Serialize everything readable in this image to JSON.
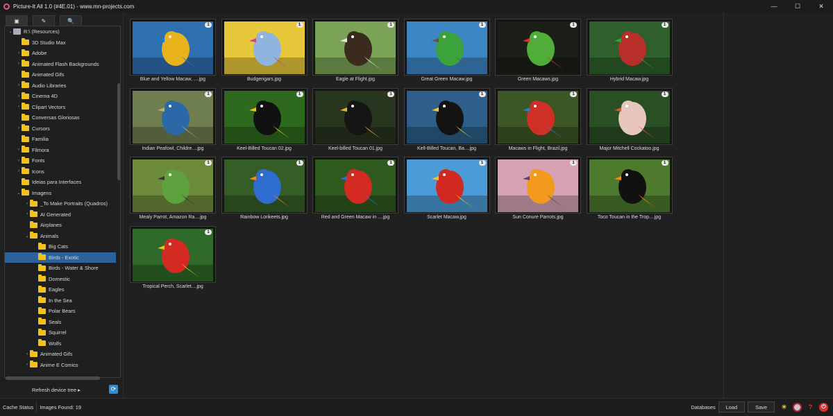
{
  "window": {
    "title": "Picture-It All 1.0 (#4E.01) - www.mn-projects.com",
    "minimize": "—",
    "maximize": "☐",
    "close": "✕"
  },
  "left_tabs": [
    "▣",
    "✎",
    "🔍"
  ],
  "tree": [
    {
      "label": "R:\\ (Resources)",
      "level": 0,
      "chev": "⌄",
      "type": "drive"
    },
    {
      "label": "3D Studio Max",
      "level": 1,
      "chev": ""
    },
    {
      "label": "Adobe",
      "level": 1,
      "chev": "›"
    },
    {
      "label": "Animated Flash Backgrounds",
      "level": 1,
      "chev": "›"
    },
    {
      "label": "Animated Gifs",
      "level": 1,
      "chev": ""
    },
    {
      "label": "Audio Libraries",
      "level": 1,
      "chev": "›"
    },
    {
      "label": "Cinema 4D",
      "level": 1,
      "chev": "›"
    },
    {
      "label": "Clipart Vectors",
      "level": 1,
      "chev": "›"
    },
    {
      "label": "Conversas Gloriosas",
      "level": 1,
      "chev": ""
    },
    {
      "label": "Cursors",
      "level": 1,
      "chev": "›"
    },
    {
      "label": "Familia",
      "level": 1,
      "chev": ""
    },
    {
      "label": "Filmora",
      "level": 1,
      "chev": "›"
    },
    {
      "label": "Fonts",
      "level": 1,
      "chev": "›"
    },
    {
      "label": "Icons",
      "level": 1,
      "chev": "›"
    },
    {
      "label": "Ideias para Interfaces",
      "level": 1,
      "chev": ""
    },
    {
      "label": "Imagens",
      "level": 1,
      "chev": "⌄"
    },
    {
      "label": "_To Make Portraits (Quadros)",
      "level": 2,
      "chev": "›"
    },
    {
      "label": "AI Generated",
      "level": 2,
      "chev": "›"
    },
    {
      "label": "Airplanes",
      "level": 2,
      "chev": ""
    },
    {
      "label": "Animals",
      "level": 2,
      "chev": "⌄"
    },
    {
      "label": "Big Cats",
      "level": 3,
      "chev": ""
    },
    {
      "label": "Birds - Exotic",
      "level": 3,
      "chev": "",
      "selected": true
    },
    {
      "label": "Birds - Water & Shore",
      "level": 3,
      "chev": ""
    },
    {
      "label": "Domestic",
      "level": 3,
      "chev": ""
    },
    {
      "label": "Eagles",
      "level": 3,
      "chev": ""
    },
    {
      "label": "In the Sea",
      "level": 3,
      "chev": ""
    },
    {
      "label": "Polar Bears",
      "level": 3,
      "chev": ""
    },
    {
      "label": "Seals",
      "level": 3,
      "chev": ""
    },
    {
      "label": "Squirrel",
      "level": 3,
      "chev": ""
    },
    {
      "label": "Wolfs",
      "level": 3,
      "chev": ""
    },
    {
      "label": "Animated Gifs",
      "level": 2,
      "chev": "›"
    },
    {
      "label": "Anime E Comics",
      "level": 2,
      "chev": "›"
    }
  ],
  "refresh_label": "Refresh device tree ▸",
  "refresh_icon": "⟳",
  "images": [
    {
      "caption": "Blue and Yellow Macaw, ....jpg",
      "badge": "1",
      "bg": "#2e6fb0",
      "bird": "#e8b21a",
      "accent": "#1f7bd0"
    },
    {
      "caption": "Budgerigars.jpg",
      "badge": "1",
      "bg": "#e7c83b",
      "bird": "#8fb4de",
      "accent": "#c9448a"
    },
    {
      "caption": "Eagle at Flight.jpg",
      "badge": "1",
      "bg": "#7aa355",
      "bird": "#3b2b1d",
      "accent": "#e6e6e6"
    },
    {
      "caption": "Great Green Macaw.jpg",
      "badge": "1",
      "bg": "#3d86c4",
      "bird": "#3aa33c",
      "accent": "#6b5234"
    },
    {
      "caption": "Green Macaws.jpg",
      "badge": "1",
      "bg": "#1b1f17",
      "bird": "#4fae38",
      "accent": "#d8302a"
    },
    {
      "caption": "Hybrid Macaw.jpg",
      "badge": "1",
      "bg": "#2f5f2a",
      "bird": "#b82f2a",
      "accent": "#3f9c3b"
    },
    {
      "caption": "Indian Peafowl, Childre....jpg",
      "badge": "1",
      "bg": "#6e7e4e",
      "bird": "#2a68a8",
      "accent": "#b6b07a"
    },
    {
      "caption": "Keel-Billed Toucan 02.jpg",
      "badge": "1",
      "bg": "#2e6a1e",
      "bird": "#111111",
      "accent": "#e6c21e"
    },
    {
      "caption": "Keel-billed Toucan 01.jpg",
      "badge": "1",
      "bg": "#28351f",
      "bird": "#151515",
      "accent": "#e4b621"
    },
    {
      "caption": "Kell-Billed Toucan, Ba....jpg",
      "badge": "1",
      "bg": "#2d5f8a",
      "bird": "#131313",
      "accent": "#f0c820"
    },
    {
      "caption": "Macaws in Flight, Brazil.jpg",
      "badge": "1",
      "bg": "#3d5724",
      "bird": "#cf2f25",
      "accent": "#2b7dc9"
    },
    {
      "caption": "Major Mitchell Cockatoo.jpg",
      "badge": "1",
      "bg": "#2a4f25",
      "bird": "#e8c6c0",
      "accent": "#d05a3a"
    },
    {
      "caption": "Mealy Parrot, Amazon Ra....jpg",
      "badge": "1",
      "bg": "#6d8a3a",
      "bird": "#5ea13f",
      "accent": "#3b3b2b"
    },
    {
      "caption": "Rainbow Lorikeets.jpg",
      "badge": "1",
      "bg": "#355e26",
      "bird": "#2f6ccf",
      "accent": "#f0881e"
    },
    {
      "caption": "Red and Green Macaw in ....jpg",
      "badge": "1",
      "bg": "#2f5a1e",
      "bird": "#d42a22",
      "accent": "#2d6fd0"
    },
    {
      "caption": "Scarlet Macaw.jpg",
      "badge": "1",
      "bg": "#4a9bd6",
      "bird": "#d1281f",
      "accent": "#f4c425"
    },
    {
      "caption": "Sun Conure Parrots.jpg",
      "badge": "1",
      "bg": "#d6a2b4",
      "bird": "#f29a1c",
      "accent": "#6a3f6a"
    },
    {
      "caption": "Toco Toucan in the Trop....jpg",
      "badge": "1",
      "bg": "#4d7a2c",
      "bird": "#111111",
      "accent": "#f08a14"
    },
    {
      "caption": "Tropical Perch, Scarlet....jpg",
      "badge": "1",
      "bg": "#2f6a2a",
      "bird": "#d42a22",
      "accent": "#f2c21b"
    }
  ],
  "status": {
    "cache": "Cache Status",
    "found": "Images Found: 19",
    "databases": "Databases",
    "load": "Load",
    "save": "Save"
  },
  "status_icons": {
    "theme": "☀",
    "help": "?",
    "power": "⏻"
  },
  "colors": {
    "selection": "#2d6199",
    "folder": "#f2c21b",
    "refresh": "#2a8fd6"
  }
}
